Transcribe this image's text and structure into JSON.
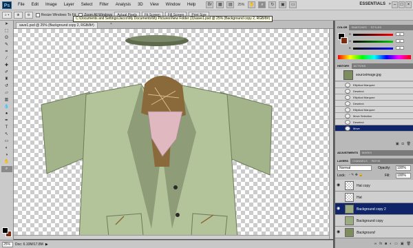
{
  "app": {
    "logo_text": "Ps",
    "menus": [
      "File",
      "Edit",
      "Image",
      "Layer",
      "Select",
      "Filter",
      "Analysis",
      "3D",
      "View",
      "Window",
      "Help"
    ],
    "zoom_readout": "25%",
    "workspace_label": "ESSENTIALS",
    "workspace_arrow": "»",
    "window_controls": [
      "–",
      "□",
      "×"
    ]
  },
  "options_bar": {
    "resize_windows_label": "Resize Windows To Fit",
    "zoom_all_label": "Zoom All Windows",
    "actual_pixels_label": "Actual Pixels",
    "fit_screen_label": "Fit Screen",
    "fill_screen_label": "Fill Screen",
    "print_size_label": "Print Size"
  },
  "tooltip": "C:\\Documents and Settings\\Jacco\\My Documents\\My Pictures\\New Folder (3)\\save1.psd @ 25% (Background copy 2, RGB/8#)",
  "document": {
    "tab_label": "save1.psd @ 25% (Background copy 2, RGB/8#)",
    "tab_close": "×"
  },
  "status": {
    "zoom": "25%",
    "doc_info": "Doc: 6.10M/17.8M",
    "arrow": "▶"
  },
  "color_panel": {
    "tabs": [
      "COLOR",
      "SWATCHES",
      "STYLES"
    ],
    "sliders": [
      {
        "label": "R",
        "value": "0",
        "color": "#e02020"
      },
      {
        "label": "G",
        "value": "0",
        "color": "#20a020"
      },
      {
        "label": "B",
        "value": "0",
        "color": "#2040e0"
      }
    ]
  },
  "history_panel": {
    "tabs": [
      "HISTORY",
      "ACTIONS"
    ],
    "source_label": "sourceimage.jpg",
    "items": [
      {
        "label": "Elliptical Marquee",
        "selected": false
      },
      {
        "label": "Deselect",
        "selected": false
      },
      {
        "label": "Elliptical Marquee",
        "selected": false
      },
      {
        "label": "Deselect",
        "selected": false
      },
      {
        "label": "Elliptical Marquee",
        "selected": false
      },
      {
        "label": "Move Selection",
        "selected": false
      },
      {
        "label": "Deselect",
        "selected": false
      },
      {
        "label": "Move",
        "selected": true
      }
    ]
  },
  "adjustments_panel": {
    "tabs": [
      "ADJUSTMENTS",
      "MASKS"
    ]
  },
  "layers_panel": {
    "tabs": [
      "LAYERS",
      "CHANNELS",
      "PATHS"
    ],
    "blend_mode": "Normal",
    "opacity_label": "Opacity:",
    "opacity_value": "100%",
    "lock_label": "Lock:",
    "fill_label": "Fill:",
    "fill_value": "100%",
    "layers": [
      {
        "name": "Hat copy",
        "visible": true,
        "selected": false
      },
      {
        "name": "Hat",
        "visible": false,
        "selected": false
      },
      {
        "name": "Background copy 2",
        "visible": true,
        "selected": true
      },
      {
        "name": "Background copy",
        "visible": false,
        "selected": false
      },
      {
        "name": "Background",
        "visible": true,
        "selected": false
      }
    ]
  },
  "colors": {
    "accent_selection": "#10246a",
    "foreground": "#000000",
    "background": "#7a2b12"
  }
}
